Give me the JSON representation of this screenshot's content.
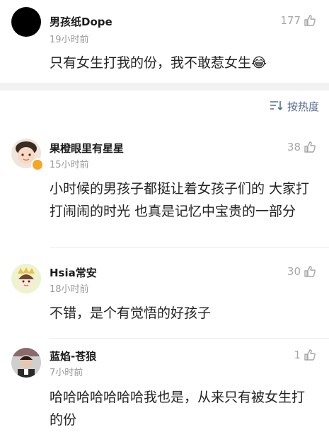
{
  "top_comment": {
    "name": "男孩纸Dope",
    "time": "19小时前",
    "likes": "177",
    "text": "只有女生打我的份，我不敢惹女生",
    "emoji": "😂"
  },
  "sort_label": "按热度",
  "comments": [
    {
      "name": "果橙眼里有星星",
      "time": "15小时前",
      "likes": "38",
      "text": "小时候的男孩子都挺让着女孩子们的 大家打打闹闹的时光 也真是记忆中宝贵的一部分"
    },
    {
      "name": "Hsia常安",
      "time": "18小时前",
      "likes": "30",
      "text": "不错，是个有觉悟的好孩子"
    },
    {
      "name": "蓝焰-苍狼",
      "time": "7小时前",
      "likes": "1",
      "text": "哈哈哈哈哈哈哈我也是，从来只有被女生打的份"
    }
  ],
  "colors": {
    "accent": "#596c8f",
    "meta": "#9a9a9a",
    "band": "#f2f2f2",
    "verified": "#f5a623"
  },
  "icons": [
    "thumbs-up-icon",
    "sort-icon",
    "verified-badge-icon",
    "laughing-emoji-icon"
  ]
}
